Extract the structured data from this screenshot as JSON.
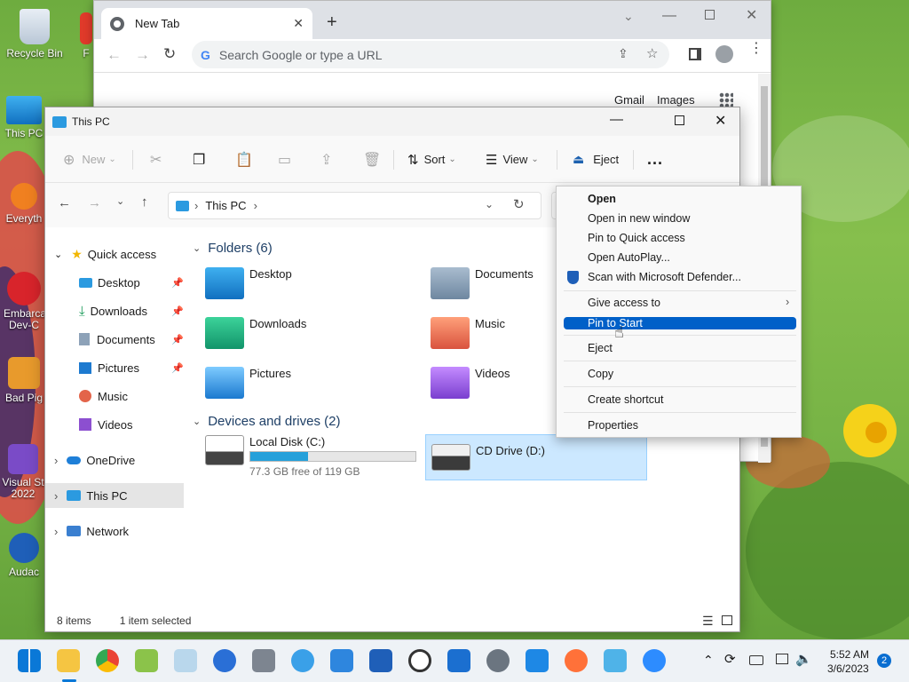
{
  "desktop": {
    "icons": [
      {
        "label": "Recycle Bin"
      },
      {
        "label": "This PC"
      },
      {
        "label": "Everyth"
      },
      {
        "label": "Embarca Dev-C"
      },
      {
        "label": "Bad Pig"
      },
      {
        "label": "Visual St 2022"
      },
      {
        "label": "Audac"
      },
      {
        "label": "F"
      }
    ]
  },
  "chrome": {
    "tab_title": "New Tab",
    "omnibox_placeholder": "Search Google or type a URL",
    "links": {
      "gmail": "Gmail",
      "images": "Images"
    }
  },
  "explorer": {
    "title": "This PC",
    "commands": {
      "new": "New",
      "sort": "Sort",
      "view": "View",
      "eject": "Eject",
      "more": "..."
    },
    "address": {
      "location": "This PC"
    },
    "nav": {
      "quick_access": "Quick access",
      "desktop": "Desktop",
      "downloads": "Downloads",
      "documents": "Documents",
      "pictures": "Pictures",
      "music": "Music",
      "videos": "Videos",
      "onedrive": "OneDrive",
      "this_pc": "This PC",
      "network": "Network"
    },
    "folders_header": "Folders (6)",
    "folders": [
      {
        "name": "Desktop"
      },
      {
        "name": "Documents"
      },
      {
        "name": "Downloads"
      },
      {
        "name": "Music"
      },
      {
        "name": "Pictures"
      },
      {
        "name": "Videos"
      }
    ],
    "drives_header": "Devices and drives (2)",
    "drives": [
      {
        "name": "Local Disk (C:)",
        "free": "77.3 GB free of 119 GB",
        "used_fraction": 0.35
      },
      {
        "name": "CD Drive (D:)"
      }
    ],
    "status": {
      "items": "8 items",
      "selected": "1 item selected"
    }
  },
  "context_menu": {
    "items": [
      {
        "label": "Open"
      },
      {
        "label": "Open in new window"
      },
      {
        "label": "Pin to Quick access"
      },
      {
        "label": "Open AutoPlay..."
      },
      {
        "label": "Scan with Microsoft Defender..."
      },
      {
        "label": "Give access to"
      },
      {
        "label": "Pin to Start"
      },
      {
        "label": "Eject"
      },
      {
        "label": "Copy"
      },
      {
        "label": "Create shortcut"
      },
      {
        "label": "Properties"
      }
    ]
  },
  "taskbar": {
    "time": "5:52 AM",
    "date": "3/6/2023",
    "notification_count": "2"
  },
  "colors": {
    "accent": "#0060c8",
    "folder_header": "#1e3f66",
    "drive_bar": "#26a0da"
  }
}
